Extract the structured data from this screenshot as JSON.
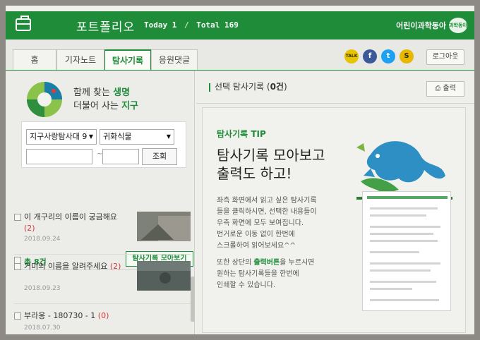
{
  "header": {
    "title": "포트폴리오",
    "today_label": "Today",
    "today_value": "1",
    "total_label": "Total",
    "total_value": "169",
    "brand": "어린이과학동아",
    "brand_logo_text": "과학동아",
    "color": "#1f8c3a"
  },
  "tabs": [
    {
      "label": "홈"
    },
    {
      "label": "기자노트"
    },
    {
      "label": "탐사기록"
    },
    {
      "label": "응원댓글"
    }
  ],
  "social": {
    "talk": "TALK",
    "facebook": "f",
    "twitter": "t",
    "kakaostory": "S"
  },
  "logout_label": "로그아웃",
  "slogan": {
    "line1_prefix": "함께 찾는 ",
    "line1_highlight": "생명",
    "line2_prefix": "더불어 사는 ",
    "line2_highlight": "지구"
  },
  "filter": {
    "select1": "지구사랑탐사대 9",
    "select2": "귀화식물",
    "date_separator": "~",
    "search_label": "조회"
  },
  "list": {
    "total_label": "총 8건",
    "collect_label": "탐사기록 모아보기",
    "items": [
      {
        "title": "이 개구리의 이름이 궁금해요",
        "count": "(2)",
        "date": "2018.09.24"
      },
      {
        "title": "거미의 이름을 알려주세요",
        "count": "(2)",
        "date": "2018.09.23"
      },
      {
        "title": "부라옹 - 180730 - 1",
        "count": "(0)",
        "date": "2018.07.30"
      }
    ]
  },
  "right": {
    "heading_prefix": "선택 탐사기록 (",
    "heading_count": "0건",
    "heading_suffix": ")",
    "print_label": "출력",
    "tip_label": "탐사기록 TIP",
    "tip_head_1": "탐사기록 모아보고",
    "tip_head_2": "출력도 하고!",
    "tip_p1_1": "좌측 화면에서 읽고 싶은 탐사기록",
    "tip_p1_2": "들을 클릭하시면, 선택한 내용들이",
    "tip_p1_3": "우측 화면에 모두 보여집니다.",
    "tip_p1_4": "번거로운 이동 없이 한번에",
    "tip_p1_5": "스크롤하여 읽어보세요^^",
    "tip_p2_1_prefix": "또한 상단의 ",
    "tip_p2_1_highlight": "출력버튼",
    "tip_p2_1_suffix": "을 누르시면",
    "tip_p2_2": "원하는 탐사기록들을 한번에",
    "tip_p2_3": "인쇄할 수 있습니다."
  },
  "icons": {
    "bag": "briefcase-icon",
    "print": "printer-icon",
    "dropdown": "chevron-down-icon"
  }
}
